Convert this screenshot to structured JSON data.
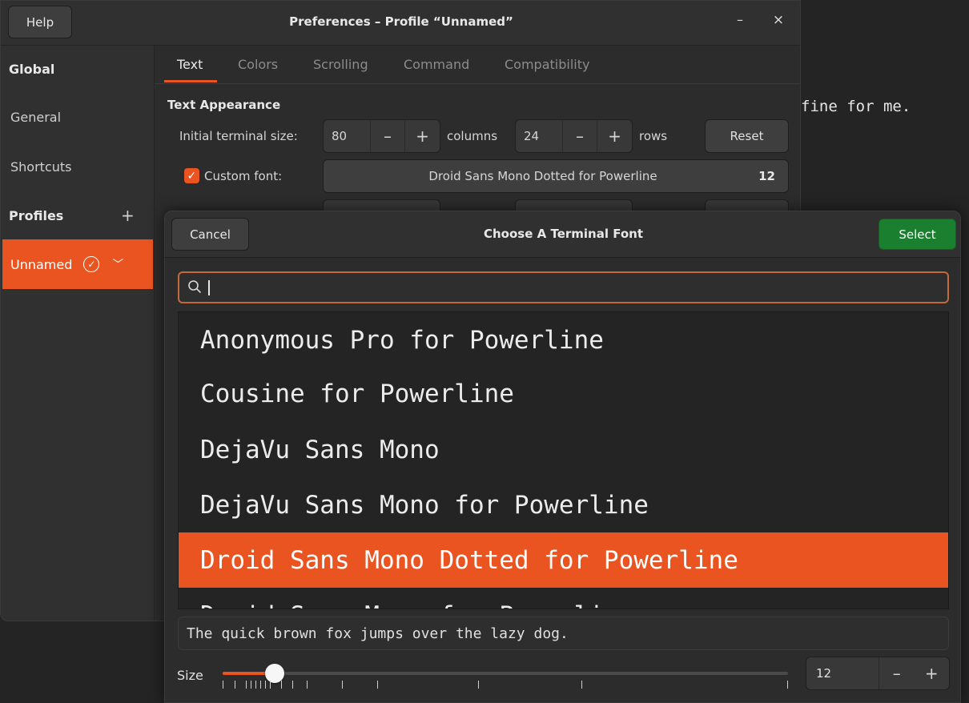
{
  "terminal": {
    "visible_text": "fine for me."
  },
  "preferences": {
    "help_label": "Help",
    "title": "Preferences – Profile “Unnamed”",
    "minimize_glyph": "–",
    "close_glyph": "×",
    "sidebar": {
      "global_heading": "Global",
      "general": "General",
      "shortcuts": "Shortcuts",
      "profiles_heading": "Profiles",
      "add_profile_glyph": "+",
      "selected_profile": "Unnamed"
    },
    "tabs": [
      "Text",
      "Colors",
      "Scrolling",
      "Command",
      "Compatibility"
    ],
    "active_tab": "Text",
    "text_appearance": {
      "section_title": "Text Appearance",
      "initial_size_label": "Initial terminal size:",
      "columns_value": "80",
      "columns_label": "columns",
      "rows_value": "24",
      "rows_label": "rows",
      "reset_label": "Reset",
      "minus_glyph": "–",
      "plus_glyph": "+",
      "custom_font_checked": true,
      "custom_font_label": "Custom font:",
      "font_name": "Droid Sans Mono Dotted for Powerline",
      "font_size": "12"
    }
  },
  "font_dialog": {
    "cancel_label": "Cancel",
    "title": "Choose A Terminal Font",
    "select_label": "Select",
    "search_value": "",
    "fonts": [
      "Anonymous Pro for Powerline",
      "Cousine for Powerline",
      "DejaVu Sans Mono",
      "DejaVu Sans Mono for Powerline",
      "Droid Sans Mono Dotted for Powerline",
      "Droid Sans Mono for Powerline"
    ],
    "selected_font_index": 4,
    "preview_text": "The quick brown fox jumps over the lazy dog.",
    "size_label": "Size",
    "size_value": "12",
    "size_slider_fraction": 0.092,
    "minus_glyph": "–",
    "plus_glyph": "+"
  },
  "colors": {
    "accent": "#e95420",
    "select_button": "#1a7f2e"
  }
}
